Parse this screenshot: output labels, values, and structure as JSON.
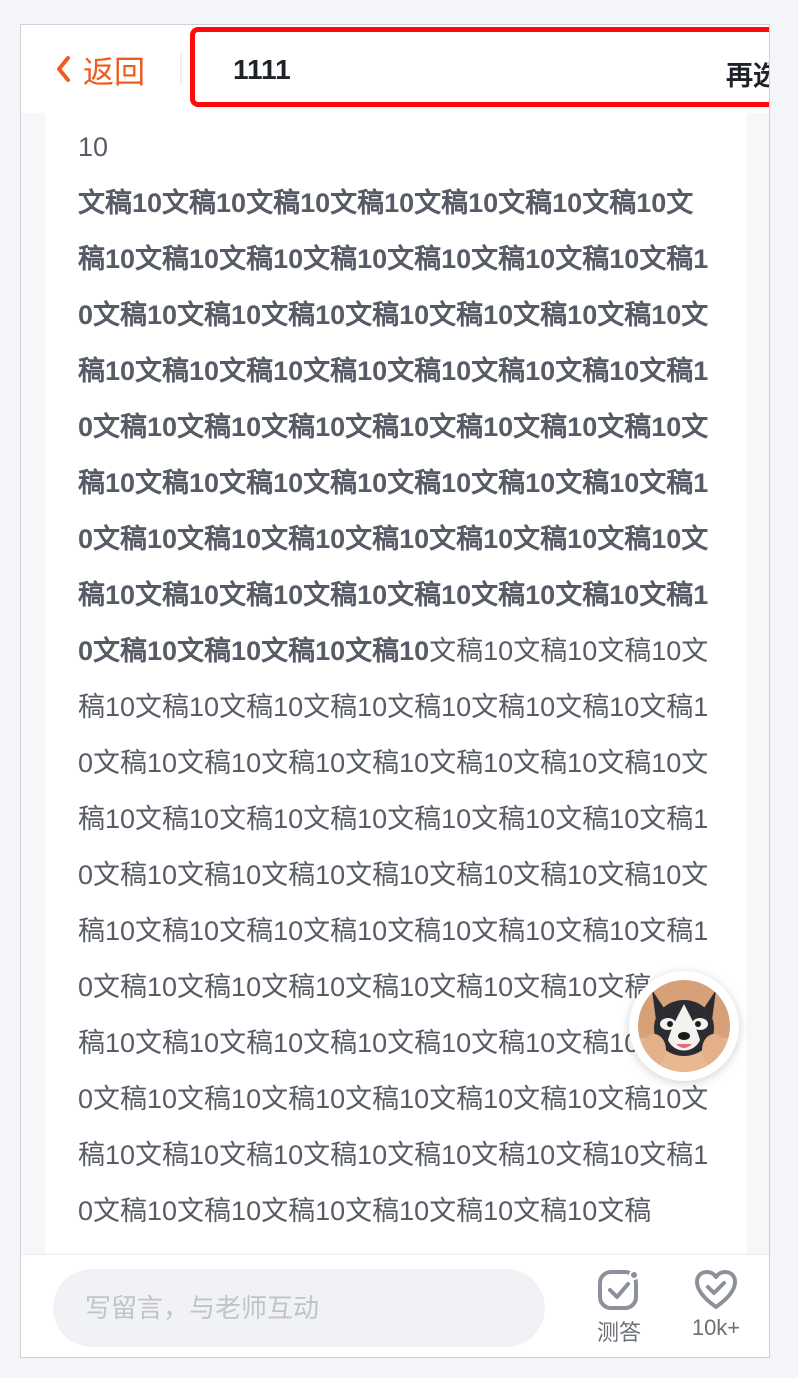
{
  "header": {
    "back_label": "返回",
    "title": "1111",
    "again_label": "再选"
  },
  "article": {
    "first_line": "10",
    "bold_text": "文稿10文稿10文稿10文稿10文稿10文稿10文稿10文稿10文稿10文稿10文稿10文稿10文稿10文稿10文稿10文稿10文稿10文稿10文稿10文稿10文稿10文稿10文稿10文稿10文稿10文稿10文稿10文稿10文稿10文稿10文稿10文稿10文稿10文稿10文稿10文稿10文稿10文稿10文稿10文稿10文稿10文稿10文稿10文稿10文稿10文稿10文稿10文稿10文稿10文稿10文稿10文稿10文稿10文稿10文稿10文稿10文稿10文稿10文稿10文稿10文稿10文稿10文稿10文稿10",
    "normal_text": "文稿10文稿10文稿10文稿10文稿10文稿10文稿10文稿10文稿10文稿10文稿10文稿10文稿10文稿10文稿10文稿10文稿10文稿10文稿10文稿10文稿10文稿10文稿10文稿10文稿10文稿10文稿10文稿10文稿10文稿10文稿10文稿10文稿10文稿10文稿10文稿10文稿10文稿10文稿10文稿10文稿10文稿10文稿10文稿10文稿10文稿10文稿10文稿10文稿10文稿10文稿10文稿10文稿10文稿10文稿10文稿10文稿10文稿10文稿10文稿10文稿10文稿10文稿10文稿10文稿10文稿10文稿10文稿10文稿10文稿10文稿10文稿10文稿10文稿10文稿10文稿10文稿10文稿"
  },
  "bottom": {
    "comment_placeholder": "写留言，与老师互动",
    "quiz_label": "测答",
    "like_count": "10k+"
  },
  "icons": {
    "back": "chevron-left-icon",
    "quiz": "quiz-check-icon",
    "like": "heart-check-icon",
    "avatar": "husky-dog-avatar"
  },
  "colors": {
    "accent": "#f05a1e",
    "highlight_border": "#ff0a0a",
    "text": "#565b66"
  }
}
